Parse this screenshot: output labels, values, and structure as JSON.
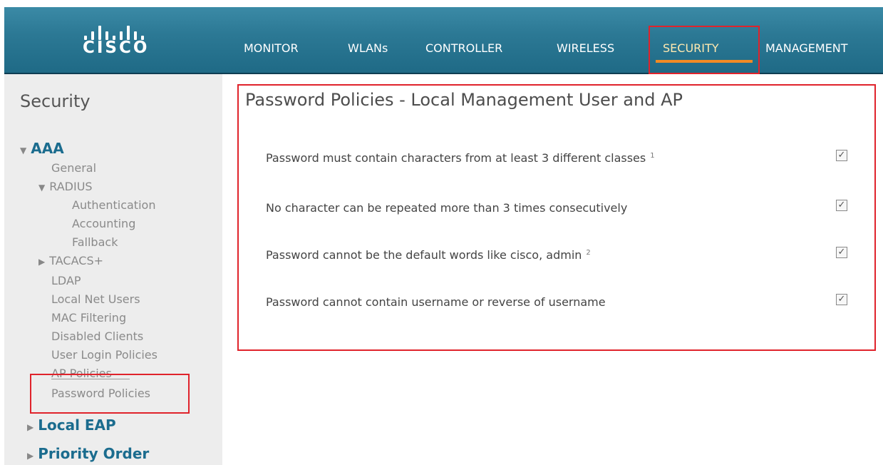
{
  "brand": {
    "logo_text": "CISCO"
  },
  "nav": {
    "items": [
      {
        "label": "MONITOR"
      },
      {
        "label": "WLANs"
      },
      {
        "label": "CONTROLLER"
      },
      {
        "label": "WIRELESS"
      },
      {
        "label": "SECURITY"
      },
      {
        "label": "MANAGEMENT"
      }
    ],
    "active": "SECURITY",
    "accent_color": "#f08a24"
  },
  "sidebar": {
    "title": "Security",
    "items": [
      {
        "label": "AAA",
        "icon": "caret-down-icon"
      },
      {
        "label": "General"
      },
      {
        "label": "RADIUS",
        "icon": "caret-down-icon"
      },
      {
        "label": "Authentication"
      },
      {
        "label": "Accounting"
      },
      {
        "label": "Fallback"
      },
      {
        "label": "TACACS+",
        "icon": "caret-right-icon"
      },
      {
        "label": "LDAP"
      },
      {
        "label": "Local Net Users"
      },
      {
        "label": "MAC Filtering"
      },
      {
        "label": "Disabled Clients"
      },
      {
        "label": "User Login Policies"
      },
      {
        "label": "AP Policies"
      },
      {
        "label": "Password Policies"
      },
      {
        "label": "Local EAP",
        "icon": "caret-right-icon"
      },
      {
        "label": "Priority Order",
        "icon": "caret-right-icon"
      }
    ]
  },
  "main": {
    "title": "Password Policies - Local Management User and AP",
    "policies": [
      {
        "label": "Password must contain characters from at least 3 different classes",
        "footnote": "1",
        "checked": true
      },
      {
        "label": "No character can be repeated more than 3 times consecutively",
        "footnote": "",
        "checked": true
      },
      {
        "label": "Password cannot be the default words like cisco, admin",
        "footnote": "2",
        "checked": true
      },
      {
        "label": "Password cannot contain username or reverse of username",
        "footnote": "",
        "checked": true
      }
    ]
  },
  "highlight_color": "#e0232b"
}
